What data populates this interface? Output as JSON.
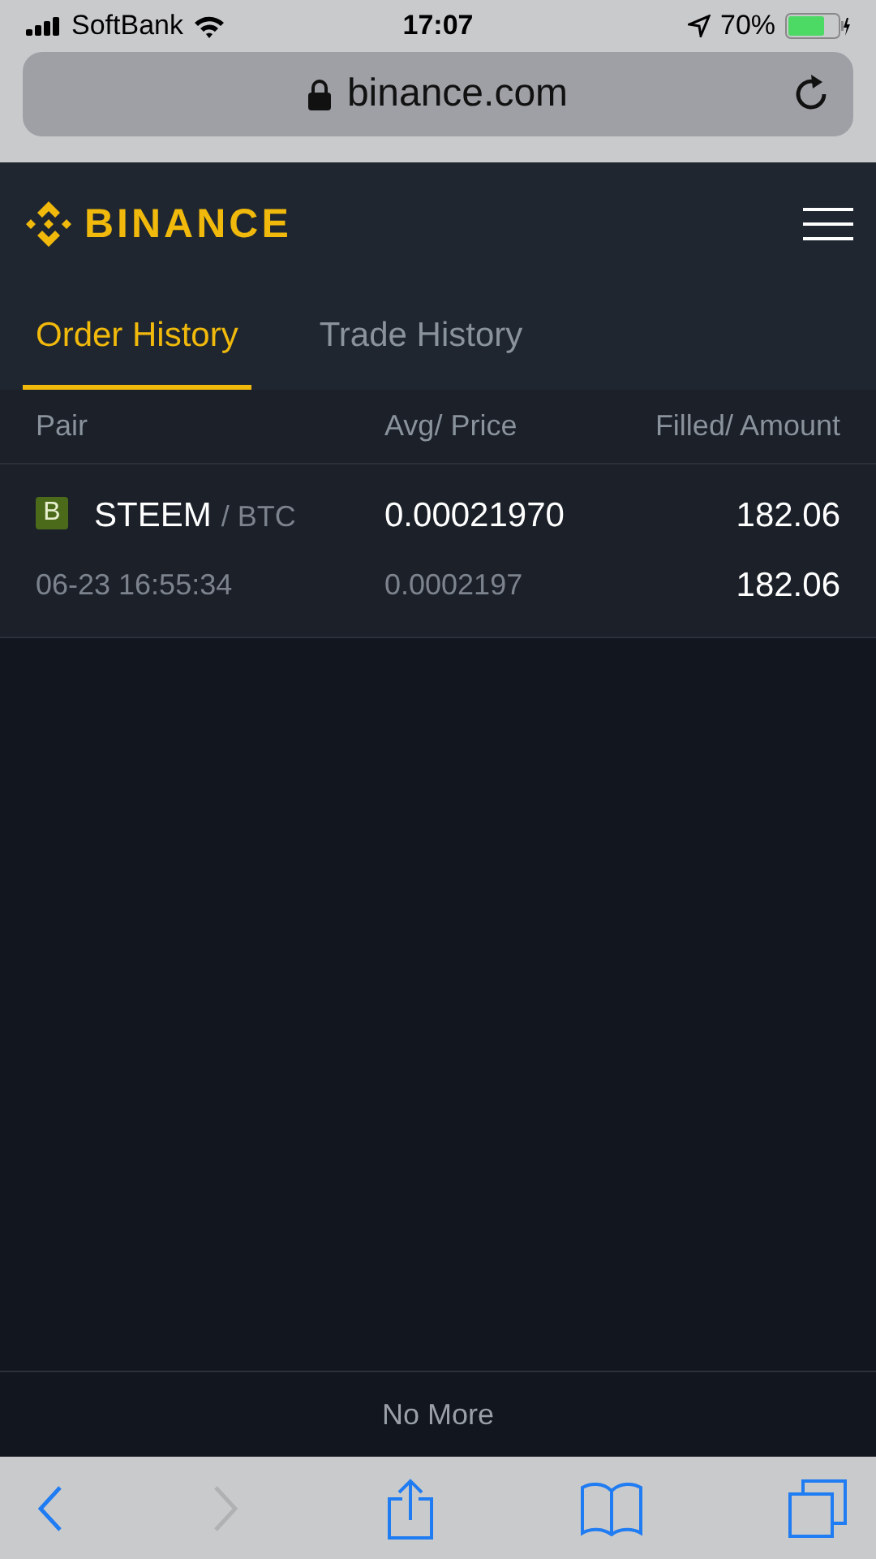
{
  "status_bar": {
    "carrier": "SoftBank",
    "time": "17:07",
    "battery": "70%"
  },
  "address_bar": {
    "url": "binance.com"
  },
  "header": {
    "logo": "BINANCE"
  },
  "tabs": [
    {
      "label": "Order History",
      "selected": true
    },
    {
      "label": "Trade History",
      "selected": false
    }
  ],
  "table": {
    "columns": [
      "Pair",
      "Avg/ Price",
      "Filled/ Amount"
    ],
    "rows": [
      {
        "side": "B",
        "color": "#4b6a1a",
        "base": "STEEM",
        "quote": "/ BTC",
        "time": "06-23 16:55:34",
        "avg": "0.00021970",
        "price": "0.0002197",
        "filled": "182.06",
        "amount": "182.06"
      }
    ]
  },
  "footer": "No More",
  "toolbar": {
    "back_disabled": false,
    "forward_disabled": true
  }
}
